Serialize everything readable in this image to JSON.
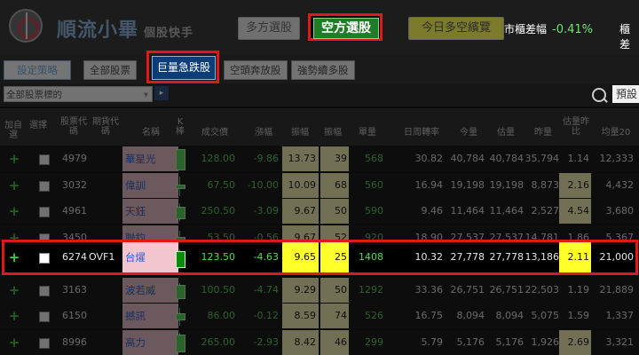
{
  "header": {
    "brand": "順流小畢",
    "brand_sub": "個股快手",
    "long_button": "多方選股",
    "short_button": "空方選股",
    "today_button": "今日多空繽覽",
    "market_label": "市櫃差幅",
    "market_value": "-0.41%",
    "market_cut_label": "櫃差"
  },
  "tabs": {
    "settings": "設定策略",
    "items": [
      "全部股票",
      "巨量急跌股",
      "空頭奔放股",
      "強勢續多股"
    ],
    "selected_index": 1
  },
  "filter": {
    "select_value": "全部股票標的",
    "preview_label": "預設"
  },
  "columns": [
    "加自選",
    "選擇",
    "股票代碼",
    "期貨代碼",
    "名稱",
    "K棒",
    "成交價",
    "漲幅",
    "振幅",
    "振幅",
    "單量",
    "日周轉率",
    "今量",
    "估量",
    "昨量",
    "估量昨比",
    "均量20"
  ],
  "rows": [
    {
      "code": "4979",
      "fut": "",
      "name": "華星光",
      "price": "128.00",
      "chg": "-9.86",
      "amp": "13.73",
      "amp2": "39",
      "vol": "568",
      "turn": "30.82",
      "today": "40,784",
      "est": "40,784",
      "yest": "35,794",
      "ratio": "1.14",
      "avg20": "12,333"
    },
    {
      "code": "3032",
      "fut": "",
      "name": "偉訓",
      "price": "67.50",
      "chg": "-10.00",
      "amp": "10.09",
      "amp2": "68",
      "vol": "560",
      "turn": "16.94",
      "today": "19,198",
      "est": "19,198",
      "yest": "8,873",
      "ratio": "2.16",
      "avg20": "4,432"
    },
    {
      "code": "4961",
      "fut": "",
      "name": "天鈺",
      "price": "250.50",
      "chg": "-3.09",
      "amp": "9.67",
      "amp2": "50",
      "vol": "590",
      "turn": "9.46",
      "today": "11,464",
      "est": "11,464",
      "yest": "2,527",
      "ratio": "4.54",
      "avg20": "3,680"
    },
    {
      "code": "3450",
      "fut": "",
      "name": "聯鈞",
      "price": "53.50",
      "chg": "-0.56",
      "amp": "9.67",
      "amp2": "52",
      "vol": "920",
      "turn": "18.90",
      "today": "27,537",
      "est": "27,537",
      "yest": "14,781",
      "ratio": "1.86",
      "avg20": "5,367"
    },
    {
      "code": "6274",
      "fut": "OVF1",
      "name": "台燿",
      "price": "123.50",
      "chg": "-4.63",
      "amp": "9.65",
      "amp2": "25",
      "vol": "1408",
      "turn": "10.32",
      "today": "27,778",
      "est": "27,778",
      "yest": "13,186",
      "ratio": "2.11",
      "avg20": "21,000"
    },
    {
      "code": "3163",
      "fut": "",
      "name": "波若威",
      "price": "100.50",
      "chg": "-4.74",
      "amp": "9.29",
      "amp2": "50",
      "vol": "1292",
      "turn": "33.36",
      "today": "26,751",
      "est": "26,751",
      "yest": "22,503",
      "ratio": "1.19",
      "avg20": "21,889"
    },
    {
      "code": "6150",
      "fut": "",
      "name": "撼訊",
      "price": "86.00",
      "chg": "-0.12",
      "amp": "8.59",
      "amp2": "74",
      "vol": "526",
      "turn": "16.75",
      "today": "8,094",
      "est": "8,094",
      "yest": "5,075",
      "ratio": "1.59",
      "avg20": "1,337"
    },
    {
      "code": "8996",
      "fut": "",
      "name": "高力",
      "price": "265.00",
      "chg": "-2.93",
      "amp": "8.42",
      "amp2": "46",
      "vol": "299",
      "turn": "5.79",
      "today": "5,176",
      "est": "5,176",
      "yest": "1,926",
      "ratio": "2.69",
      "avg20": "3,321"
    }
  ],
  "highlighted_row_index": 4,
  "colors": {
    "accent_red": "#e01818",
    "green_button": "#1e7d26",
    "yellow_cell": "#ffff2a",
    "name_bg": "#f3c6cf"
  }
}
